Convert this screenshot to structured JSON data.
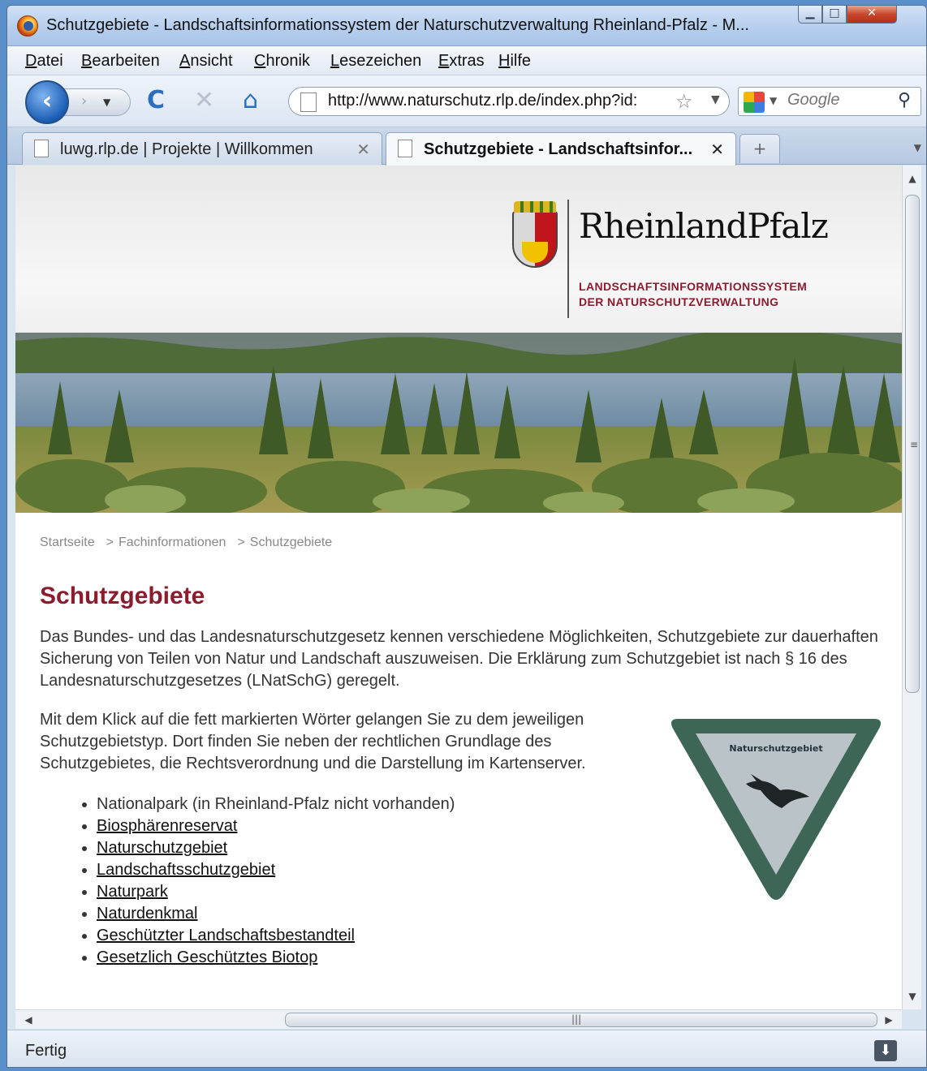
{
  "window": {
    "title": "Schutzgebiete - Landschaftsinformationssystem der Naturschutzverwaltung Rheinland-Pfalz - M..."
  },
  "menu": [
    "Datei",
    "Bearbeiten",
    "Ansicht",
    "Chronik",
    "Lesezeichen",
    "Extras",
    "Hilfe"
  ],
  "nav": {
    "url": "http://www.naturschutz.rlp.de/index.php?id:",
    "search_placeholder": "Google"
  },
  "tabs": [
    {
      "label": "luwg.rlp.de | Projekte | Willkommen",
      "active": false
    },
    {
      "label": "Schutzgebiete - Landschaftsinfor...",
      "active": true
    }
  ],
  "page": {
    "logo": {
      "wordmark": "RheinlandPfalz",
      "sub_line1": "LANDSCHAFTSINFORMATIONSSYSTEM",
      "sub_line2": "DER NATURSCHUTZVERWALTUNG"
    },
    "breadcrumb": [
      "Startseite",
      "Fachinformationen",
      "Schutzgebiete"
    ],
    "breadcrumb_sep": ">",
    "title": "Schutzgebiete",
    "intro": "Das Bundes- und das Landesnaturschutzgesetz kennen verschiedene Möglichkeiten, Schutzgebiete zur dauerhaften Sicherung von Teilen von Natur und Landschaft auszuweisen. Die Erklärung zum Schutzgebiet ist nach § 16 des Landesnaturschutzgesetzes (LNatSchG) geregelt.",
    "hint": "Mit dem Klick auf die fett markierten Wörter gelangen Sie zu dem jeweiligen Schutzgebietstyp. Dort finden Sie neben der rechtlichen Grundlage des Schutzgebietes, die Rechtsverordnung und die Darstellung im Kartenserver.",
    "area_types": [
      {
        "label": "Nationalpark (in Rheinland-Pfalz nicht vorhanden)",
        "link": false
      },
      {
        "label": "Biosphärenreservat",
        "link": true
      },
      {
        "label": "Naturschutzgebiet",
        "link": true
      },
      {
        "label": "Landschaftsschutzgebiet",
        "link": true
      },
      {
        "label": "Naturpark",
        "link": true
      },
      {
        "label": "Naturdenkmal",
        "link": true
      },
      {
        "label": "Geschützter Landschaftsbestandteil",
        "link": true
      },
      {
        "label": "Gesetzlich Geschütztes Biotop",
        "link": true
      }
    ],
    "sign_text": "Naturschutzgebiet"
  },
  "status": {
    "text": "Fertig"
  },
  "colors": {
    "accent": "#8b1c2e",
    "sign_border": "#3e6657",
    "sign_fill": "#b9c3c8"
  }
}
